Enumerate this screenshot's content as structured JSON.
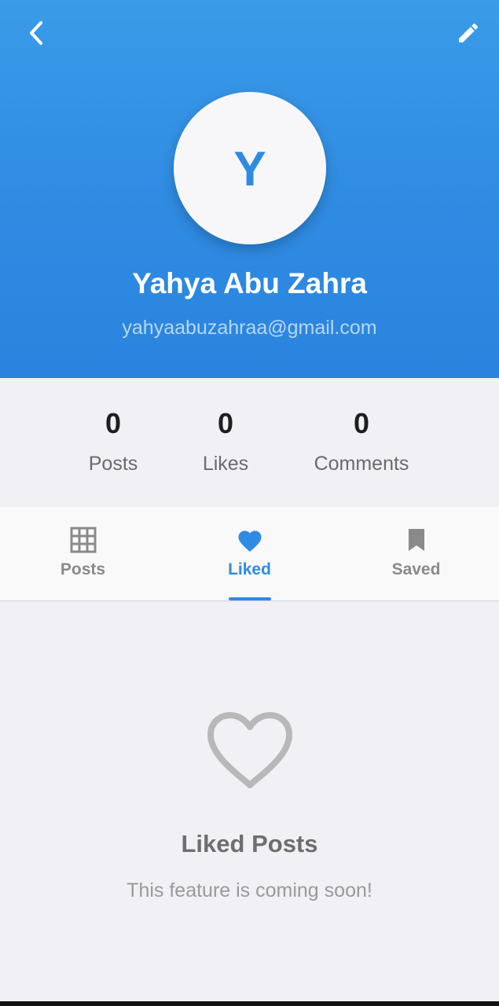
{
  "header": {
    "back_icon": "chevron-left-icon",
    "edit_icon": "pencil-icon",
    "avatar_initial": "Y",
    "name": "Yahya Abu Zahra",
    "email": "yahyaabuzahraa@gmail.com"
  },
  "stats": [
    {
      "value": "0",
      "label": "Posts"
    },
    {
      "value": "0",
      "label": "Likes"
    },
    {
      "value": "0",
      "label": "Comments"
    }
  ],
  "tabs": [
    {
      "label": "Posts",
      "icon": "grid-icon",
      "active": false
    },
    {
      "label": "Liked",
      "icon": "heart-icon",
      "active": true
    },
    {
      "label": "Saved",
      "icon": "bookmark-icon",
      "active": false
    }
  ],
  "empty_state": {
    "icon": "heart-outline-icon",
    "title": "Liked Posts",
    "subtitle": "This feature is coming soon!"
  },
  "colors": {
    "primary": "#2f8be2",
    "header_gradient_top": "#3a9be9",
    "background": "#f0f0f5",
    "inactive": "#8a8a8a"
  }
}
